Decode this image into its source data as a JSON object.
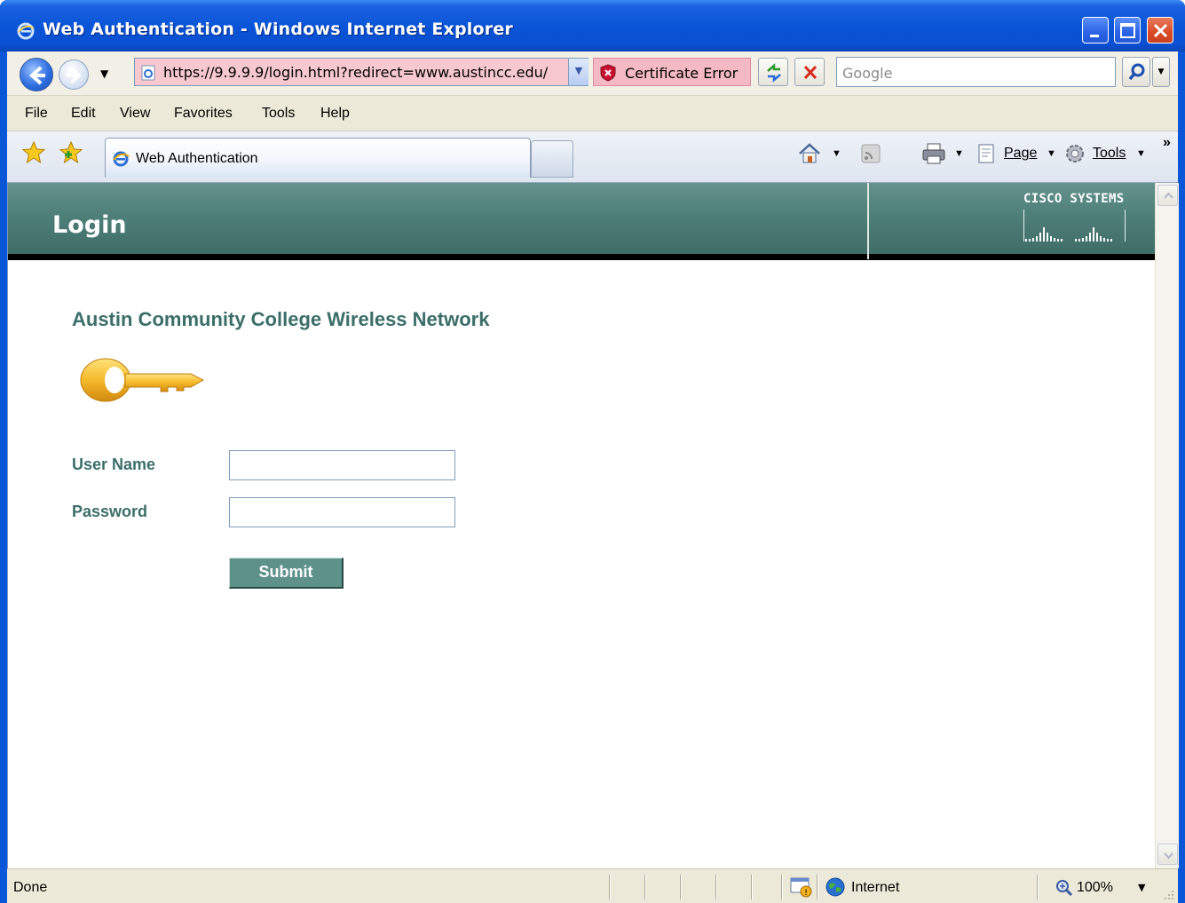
{
  "window": {
    "title": "Web Authentication - Windows Internet Explorer"
  },
  "addressbar": {
    "url": "https://9.9.9.9/login.html?redirect=www.austincc.edu/",
    "cert_error": "Certificate Error",
    "search_placeholder": "Google"
  },
  "menu": {
    "items": [
      "File",
      "Edit",
      "View",
      "Favorites",
      "Tools",
      "Help"
    ]
  },
  "tabs": {
    "active_label": "Web Authentication"
  },
  "commandbar": {
    "page_label": "Page",
    "tools_label": "Tools"
  },
  "page": {
    "header_title": "Login",
    "brand": "Cisco Systems",
    "network_title": "Austin Community College Wireless Network",
    "username_label": "User Name",
    "password_label": "Password",
    "username_value": "",
    "password_value": "",
    "submit_label": "Submit"
  },
  "status": {
    "text": "Done",
    "zone": "Internet",
    "zoom": "100%"
  },
  "colors": {
    "titlebar_blue": "#0a55d9",
    "header_teal": "#4f7f79",
    "label_teal": "#3c6e69",
    "button_teal": "#5e918a",
    "cert_error_pink": "#f5b9c3"
  }
}
